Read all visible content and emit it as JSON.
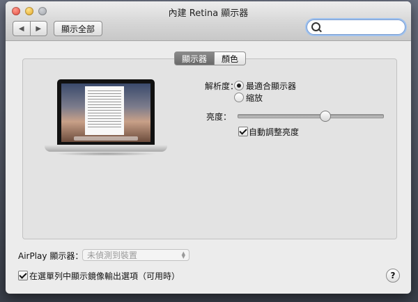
{
  "window": {
    "title": "內建 Retina 顯示器"
  },
  "toolbar": {
    "back": "◀",
    "forward": "▶",
    "show_all": "顯示全部",
    "search_value": "",
    "search_placeholder": ""
  },
  "tabs": [
    {
      "label": "顯示器",
      "active": true
    },
    {
      "label": "顏色",
      "active": false
    }
  ],
  "display": {
    "resolution_label": "解析度：",
    "resolution_options": [
      {
        "label": "最適合顯示器",
        "selected": true
      },
      {
        "label": "縮放",
        "selected": false
      }
    ],
    "brightness_label": "亮度：",
    "brightness_level": 0.6,
    "auto_brightness_label": "自動調整亮度",
    "auto_brightness_checked": true
  },
  "airplay": {
    "label": "AirPlay 顯示器：",
    "selected": "未偵測到裝置"
  },
  "mirroring": {
    "label": "在選單列中顯示鏡像輸出選項（可用時）",
    "checked": true
  },
  "help": {
    "label": "?"
  }
}
